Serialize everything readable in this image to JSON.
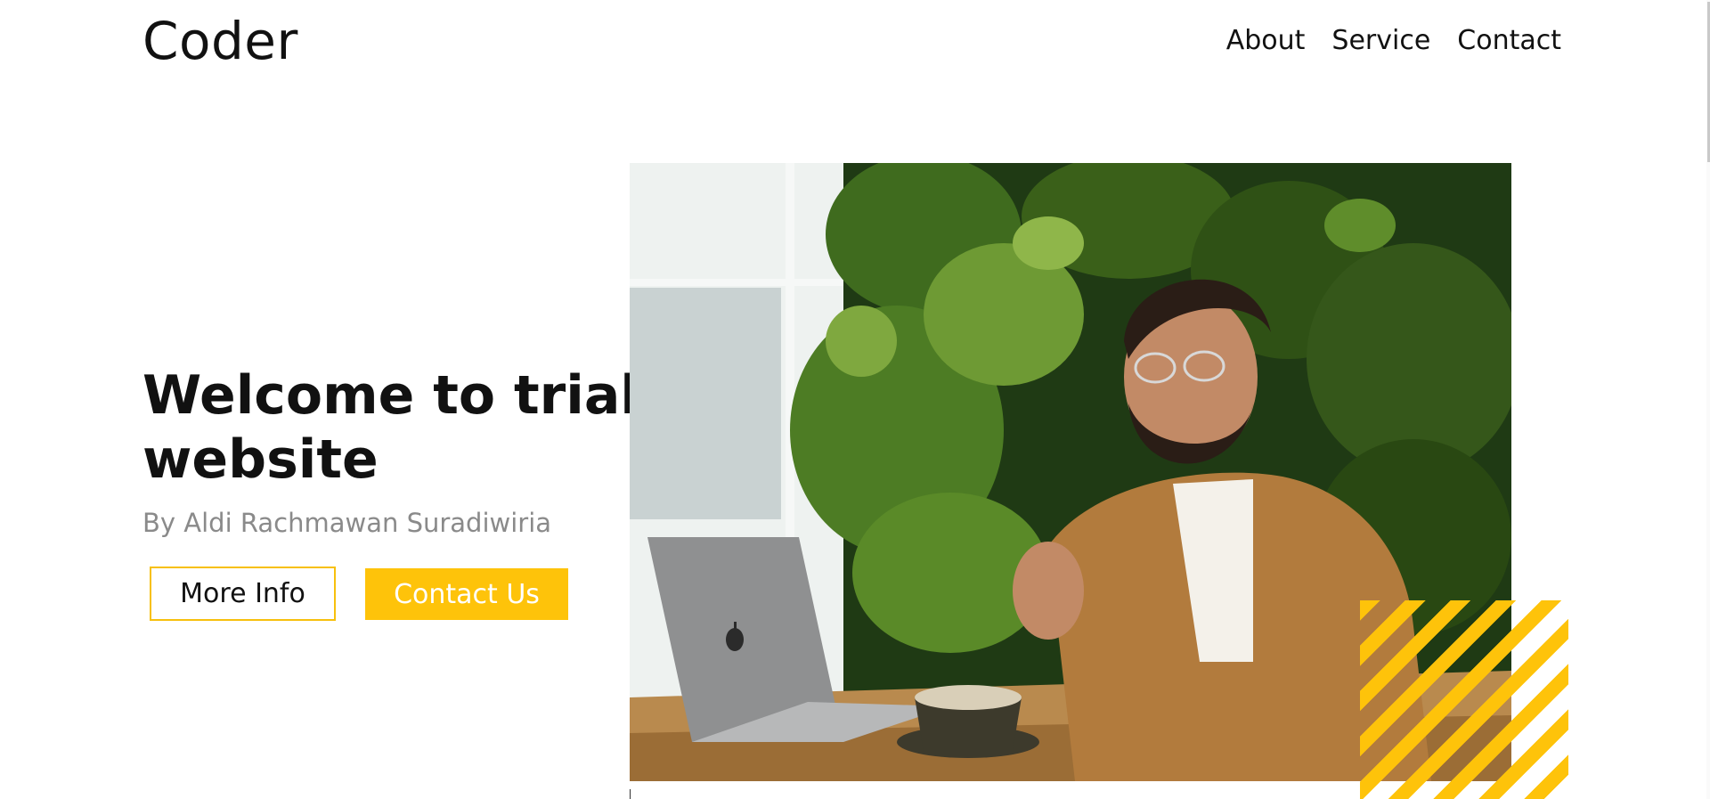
{
  "header": {
    "logo": "Coder",
    "nav": [
      {
        "label": "About"
      },
      {
        "label": "Service"
      },
      {
        "label": "Contact"
      }
    ]
  },
  "hero": {
    "title": "Welcome to trial website",
    "subtitle": "By Aldi Rachmawan Suradiwiria",
    "buttons": {
      "more_info": "More Info",
      "contact_us": "Contact Us"
    }
  },
  "colors": {
    "accent": "#fec30a",
    "text": "#111111",
    "subtitle": "#8a8a8a",
    "background": "#ffffff"
  },
  "icons": {
    "laptop_logo": "apple-logo-icon"
  }
}
